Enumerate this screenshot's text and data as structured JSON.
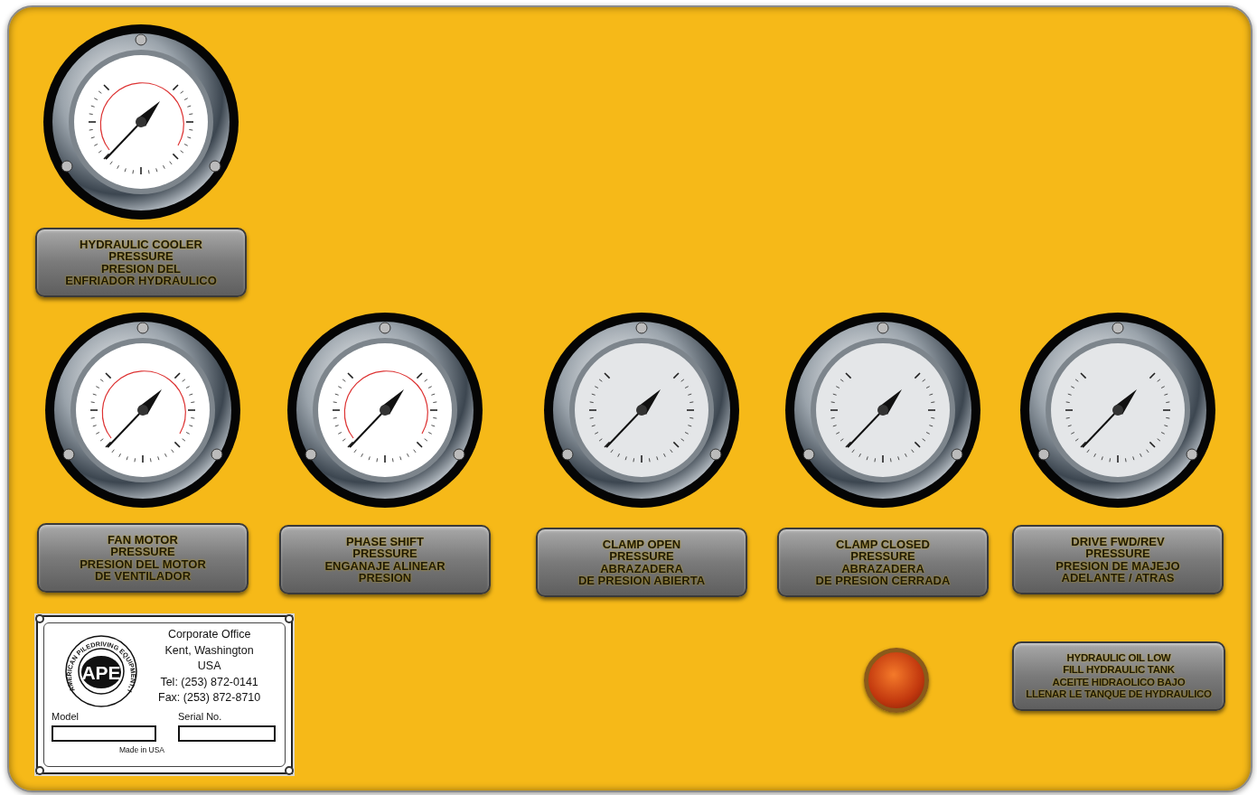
{
  "panel": {
    "top_gauges": [
      {
        "kind": "black-bezel",
        "label": [
          "HYDRAULIC COOLER",
          "PRESSURE",
          "PRESION DEL",
          "ENFRIADOR HYDRAULICO"
        ]
      }
    ],
    "gauges": [
      {
        "kind": "black-bezel",
        "label": [
          "FAN MOTOR",
          "PRESSURE",
          "PRESION DEL MOTOR",
          "DE VENTILADOR"
        ]
      },
      {
        "kind": "black-bezel",
        "label": [
          "PHASE SHIFT",
          "PRESSURE",
          "ENGANAJE ALINEAR",
          "PRESION"
        ]
      },
      {
        "kind": "chrome",
        "label": [
          "CLAMP OPEN",
          "PRESSURE",
          "ABRAZADERA",
          "DE PRESION ABIERTA"
        ]
      },
      {
        "kind": "chrome",
        "label": [
          "CLAMP CLOSED",
          "PRESSURE",
          "ABRAZADERA",
          "DE PRESION CERRADA"
        ]
      },
      {
        "kind": "chrome",
        "label": [
          "DRIVE FWD/REV",
          "PRESSURE",
          "PRESION DE MAJEJO",
          "ADELANTE / ATRAS"
        ]
      }
    ],
    "nameplate": {
      "logo_ring_text": "AMERICAN PILEDRIVING EQUIPMENT, INC.",
      "logo_text": "APE",
      "address": [
        "Corporate Office",
        "Kent, Washington",
        "USA",
        "Tel: (253) 872-0141",
        "Fax: (253) 872-8710"
      ],
      "fields": [
        {
          "label": "Model"
        },
        {
          "label": "Serial No."
        }
      ],
      "footer": "Made in USA"
    },
    "warning": {
      "lamp_on": true,
      "label": [
        "HYDRAULIC OIL LOW",
        "FILL HYDRAULIC TANK",
        "ACEITE HIDRAOLICO BAJO",
        "LLENAR LE TANQUE DE HYDRAULICO"
      ]
    }
  }
}
